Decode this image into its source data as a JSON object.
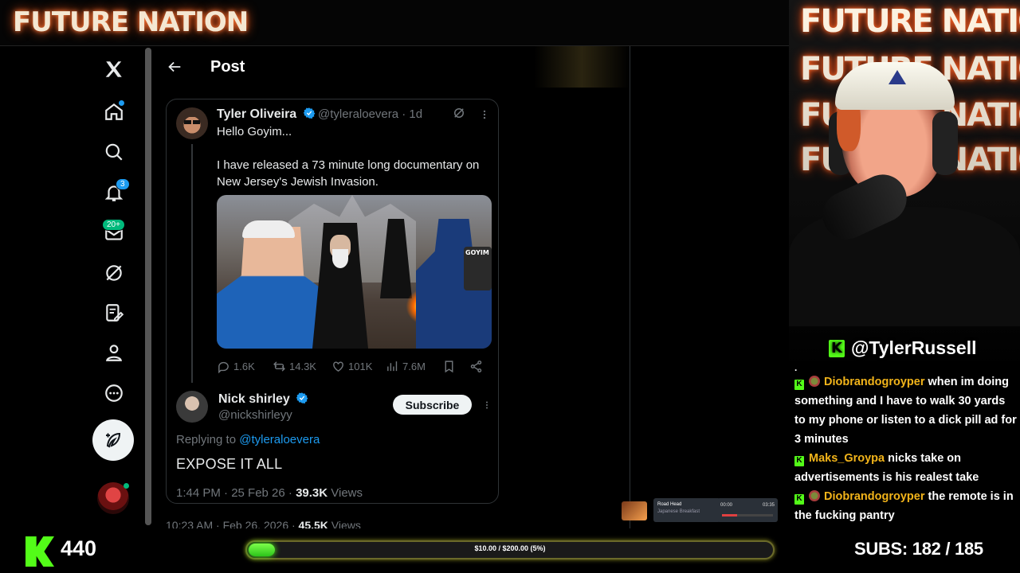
{
  "stream": {
    "brand": "FUTURE NATION",
    "cam_brand_lines": [
      "FUTURE NATION",
      "FUTURE NATION",
      "FUTURE NATION",
      "FUTURE NATION"
    ],
    "handle": "@TylerRussell",
    "followers": "440",
    "goal_text": "$10.00 / $200.00 (5%)",
    "goal_fraction": 0.05,
    "subs_label": "SUBS:",
    "subs_value": "182 / 185",
    "accent_color": "#53fc18"
  },
  "x": {
    "nav": {
      "notifications_badge": "3",
      "messages_badge": "20+"
    },
    "header": {
      "title": "Post"
    },
    "tweet": {
      "name": "Tyler Oliveira",
      "handle_time": "@tyleraloevera · 1d",
      "text_1": "Hello Goyim...",
      "text_2": "I have released a 73 minute long documentary on New Jersey's Jewish Invasion.",
      "image_vest_label": "GOYIM",
      "replies": "1.6K",
      "reposts": "14.3K",
      "likes": "101K",
      "views": "7.6M"
    },
    "reply": {
      "name": "Nick shirley",
      "handle": "@nickshirleyy",
      "subscribe_label": "Subscribe",
      "replying_prefix": "Replying to",
      "replying_to": "@tyleraloevera",
      "text": "EXPOSE IT ALL",
      "meta_time": "1:44 PM · 25 Feb 26 · ",
      "meta_views_count": "39.3K",
      "meta_views_label": " Views"
    },
    "next_meta": {
      "time": "10:23 AM · Feb 26, 2026 · ",
      "views_count": "45.5K",
      "views_label": " Views"
    }
  },
  "widget": {
    "title": "Road Head",
    "subtitle": "Japanese Breakfast",
    "time_start": "00:00",
    "time_end": "03:35"
  },
  "chat": [
    {
      "user": "Diobrandogroyper",
      "text": " when im doing something and I have to walk 30 yards to my phone or listen to a dick pill ad for 3 minutes",
      "badge": true,
      "color": "#f2b41a"
    },
    {
      "user": "Maks_Groypa",
      "text": " nicks take on advertisements is his realest take",
      "badge": false,
      "color": "#f2b41a"
    },
    {
      "user": "Diobrandogroyper",
      "text": " the remote is in the fucking pantry",
      "badge": true,
      "color": "#f2b41a"
    }
  ]
}
